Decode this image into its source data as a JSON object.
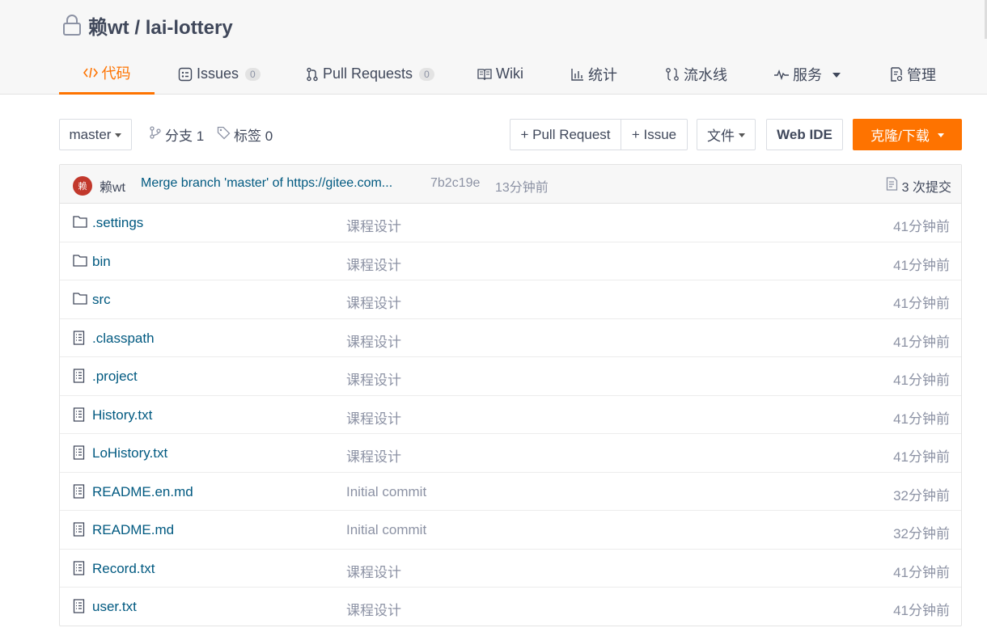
{
  "repo": {
    "owner": "赖wt",
    "separator": " / ",
    "name": "lai-lottery"
  },
  "tabs": [
    {
      "label": "代码",
      "icon": "code-icon",
      "active": true
    },
    {
      "label": "Issues",
      "count": "0",
      "icon": "issues-icon"
    },
    {
      "label": "Pull Requests",
      "count": "0",
      "icon": "pull-request-icon"
    },
    {
      "label": "Wiki",
      "icon": "book-icon"
    },
    {
      "label": "统计",
      "icon": "chart-icon"
    },
    {
      "label": "流水线",
      "icon": "pipeline-icon"
    },
    {
      "label": "服务",
      "icon": "pulse-icon",
      "dropdown": true
    },
    {
      "label": "管理",
      "icon": "settings-doc-icon"
    }
  ],
  "toolbar": {
    "branch": "master",
    "branches_label": "分支 1",
    "tags_label": "标签 0",
    "new_pr": "+ Pull Request",
    "new_issue": "+ Issue",
    "file_menu": "文件",
    "web_ide": "Web IDE",
    "clone": "克隆/下载"
  },
  "commit": {
    "avatar_text": "赖",
    "author": "赖wt",
    "message": "Merge branch 'master' of https://gitee.com...",
    "hash": "7b2c19e",
    "time": "13分钟前",
    "count_label": "3 次提交"
  },
  "files": [
    {
      "name": ".settings",
      "type": "folder",
      "message": "课程设计",
      "time": "41分钟前"
    },
    {
      "name": "bin",
      "type": "folder",
      "message": "课程设计",
      "time": "41分钟前"
    },
    {
      "name": "src",
      "type": "folder",
      "message": "课程设计",
      "time": "41分钟前"
    },
    {
      "name": ".classpath",
      "type": "file",
      "message": "课程设计",
      "time": "41分钟前"
    },
    {
      "name": ".project",
      "type": "file",
      "message": "课程设计",
      "time": "41分钟前"
    },
    {
      "name": "History.txt",
      "type": "file",
      "message": "课程设计",
      "time": "41分钟前"
    },
    {
      "name": "LoHistory.txt",
      "type": "file",
      "message": "课程设计",
      "time": "41分钟前"
    },
    {
      "name": "README.en.md",
      "type": "file",
      "message": "Initial commit",
      "time": "32分钟前"
    },
    {
      "name": "README.md",
      "type": "file",
      "message": "Initial commit",
      "time": "32分钟前"
    },
    {
      "name": "Record.txt",
      "type": "file",
      "message": "课程设计",
      "time": "41分钟前"
    },
    {
      "name": "user.txt",
      "type": "file",
      "message": "课程设计",
      "time": "41分钟前"
    }
  ],
  "colors": {
    "accent": "#fe7300",
    "link": "#005980",
    "muted": "#8c92a4",
    "avatar_bg": "#c2382c"
  }
}
